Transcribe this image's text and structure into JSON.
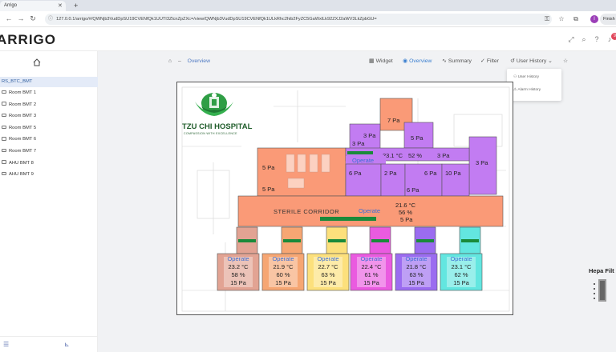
{
  "browser": {
    "tab_title": "Arrigo",
    "url": "127.0.0.1/arrigo/#/QWNjb3VudDpSU19CVENfQk1UUTI3ZlcnZpZXc=/view/QWNjb3VudDpSU19CVENfQk1ULkRhc2hib2FyZC5GaWxlLk92ZXJ2aWV3LkZpbGU=",
    "profile_initial": "I",
    "finish_label": "Finish",
    "notification_count": "9"
  },
  "app": {
    "logo": "ARRIGO"
  },
  "sidebar": {
    "root": "RS_BTC_BMT",
    "items": [
      "Room BMT 1",
      "Room BMT 2",
      "Room BMT 3",
      "Room BMT 5",
      "Room BMT 6",
      "Room BMT 7",
      "AHU BMT 8",
      "AHU BMT 9"
    ]
  },
  "main": {
    "breadcrumb": "Overview",
    "views": {
      "widget": "Widget",
      "overview": "Overview",
      "summary": "Summary",
      "filter": "Filter",
      "user_history": "User History"
    },
    "dropdown": {
      "user_history": "User History",
      "alarm_history": "Alarm History"
    },
    "hepa_label": "Hepa Filt"
  },
  "floorplan": {
    "hospital_name": "TZU CHI HOSPITAL",
    "hospital_tagline": "COMPASSION WITH EXCELLENCE",
    "corridor_label": "STERILE CORRIDOR",
    "corridor": {
      "temp": "21.6 °C",
      "humidity": "56 %",
      "pressure": "5 Pa",
      "status": "Operate"
    },
    "top": {
      "room_a": "7 Pa",
      "room_b1": "3 Pa",
      "room_b2": "3 Pa",
      "room_c": "5 Pa",
      "band_temp": "23.1 °C",
      "band_hum": "52 %",
      "band_pa": "3 Pa",
      "band_status": "Operate",
      "r1": "6 Pa",
      "r2": "2 Pa",
      "r3": "6 Pa",
      "r4": "10 Pa",
      "r5": "6 Pa",
      "r6": "3 Pa",
      "doctor_a": "5 Pa",
      "doctor_b": "5 Pa"
    },
    "rooms": [
      {
        "status": "Operate",
        "temp": "23.2 °C",
        "hum": "58 %",
        "pa": "15 Pa",
        "color": "#e2a393"
      },
      {
        "status": "Operate",
        "temp": "21.9 °C",
        "hum": "60 %",
        "pa": "15 Pa",
        "color": "#f6a673"
      },
      {
        "status": "Operate",
        "temp": "22.7 °C",
        "hum": "63 %",
        "pa": "15 Pa",
        "color": "#fce07c"
      },
      {
        "status": "Operate",
        "temp": "22.4 °C",
        "hum": "61 %",
        "pa": "15 Pa",
        "color": "#ea5be0"
      },
      {
        "status": "Operate",
        "temp": "21.8 °C",
        "hum": "63 %",
        "pa": "15 Pa",
        "color": "#9b6cf0"
      },
      {
        "status": "Operate",
        "temp": "23.1 °C",
        "hum": "62 %",
        "pa": "15 Pa",
        "color": "#63e6e0"
      }
    ],
    "colors": {
      "salmon": "#fa9a77",
      "purple": "#c27cf2",
      "green": "#1a8a3a",
      "blue": "#3d6fd4"
    }
  }
}
